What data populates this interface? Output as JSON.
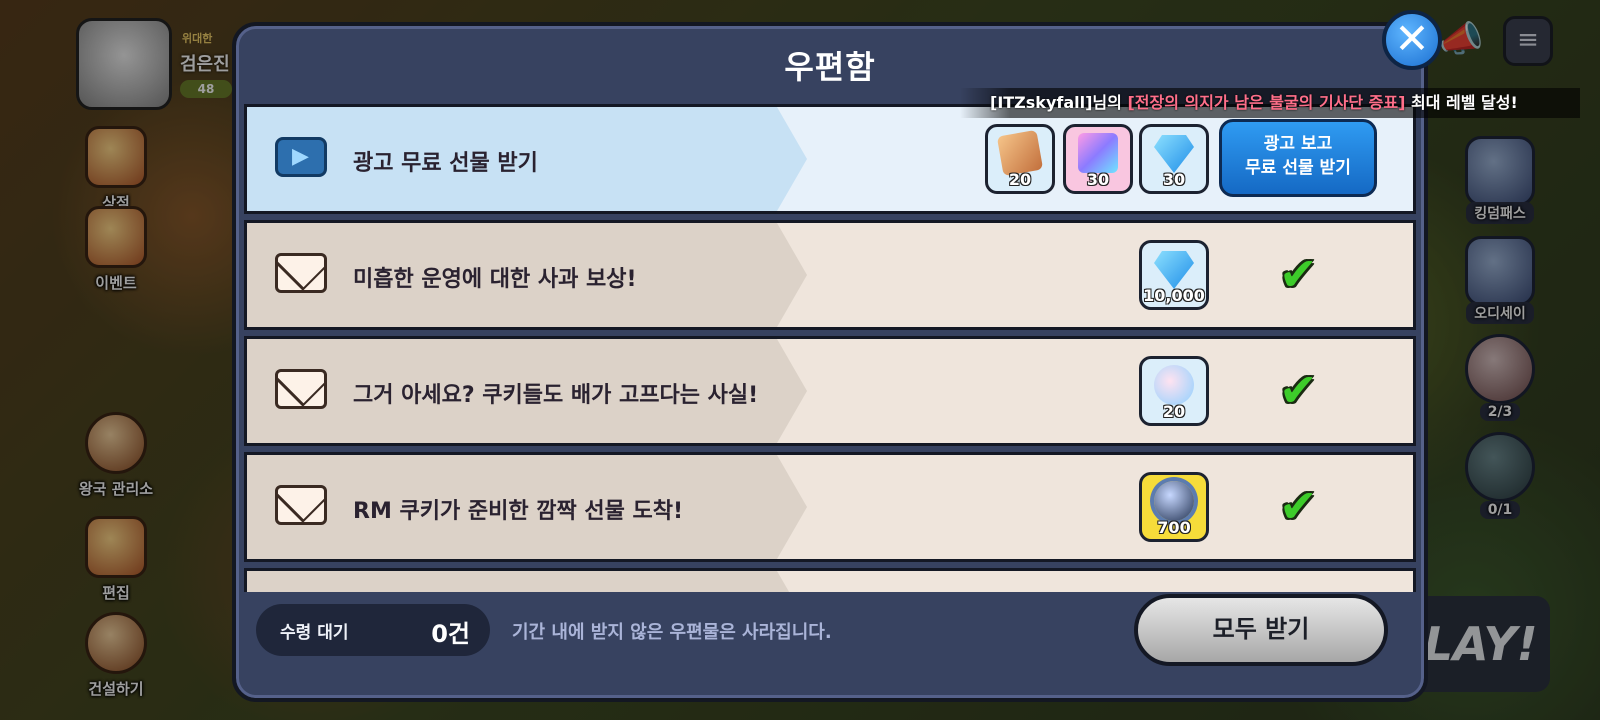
{
  "hud": {
    "profile_title": "위대한",
    "profile_name": "검은진",
    "profile_level": "48",
    "left_menu": [
      {
        "label": "상점"
      },
      {
        "label": "이벤트"
      },
      {
        "label": "왕국 관리소"
      },
      {
        "label": "편집"
      },
      {
        "label": "건설하기"
      }
    ],
    "right_menu": [
      {
        "label": "킹덤패스"
      },
      {
        "label": "오디세이"
      },
      {
        "label": "2/3"
      },
      {
        "label": "0/1"
      }
    ],
    "play_label": "PLAY!"
  },
  "notice": {
    "user": "[ITZskyfall]",
    "mid": "님의 ",
    "highlight": "[전장의 의지가 남은 불굴의 기사단 증표]",
    "tail": " 최대 레벨 달성!"
  },
  "mailbox": {
    "title": "우편함",
    "close_icon": "close-icon",
    "ad_row": {
      "title": "광고 무료 선물 받기",
      "icon": "film-play-icon",
      "rewards": [
        {
          "icon": "card-ticket-icon",
          "qty": "20"
        },
        {
          "icon": "rainbow-cube-icon",
          "qty": "30"
        },
        {
          "icon": "crystal-gem-icon",
          "qty": "30"
        }
      ],
      "button_line1": "광고 보고",
      "button_line2": "무료 선물 받기"
    },
    "mails": [
      {
        "title": "미흡한 운영에 대한 사과 보상!",
        "reward_icon": "crystal-gem-icon",
        "qty": "10,000"
      },
      {
        "title": "그거 아세요? 쿠키들도 배가 고프다는 사실!",
        "reward_icon": "candy-bag-icon",
        "qty": "20"
      },
      {
        "title": "RM 쿠키가 준비한 깜짝 선물 도착!",
        "reward_icon": "planet-orb-icon",
        "qty": "700"
      }
    ],
    "footer": {
      "pending_label": "수령 대기",
      "pending_count": "0건",
      "note": "기간 내에 받지 않은 우편물은 사라집니다.",
      "receive_all": "모두 받기"
    }
  },
  "colors": {
    "modal_bg": "#374260",
    "ad_button": "#1e7fe0",
    "check": "#3dcc2a",
    "notice_highlight": "#ff6f8a"
  }
}
